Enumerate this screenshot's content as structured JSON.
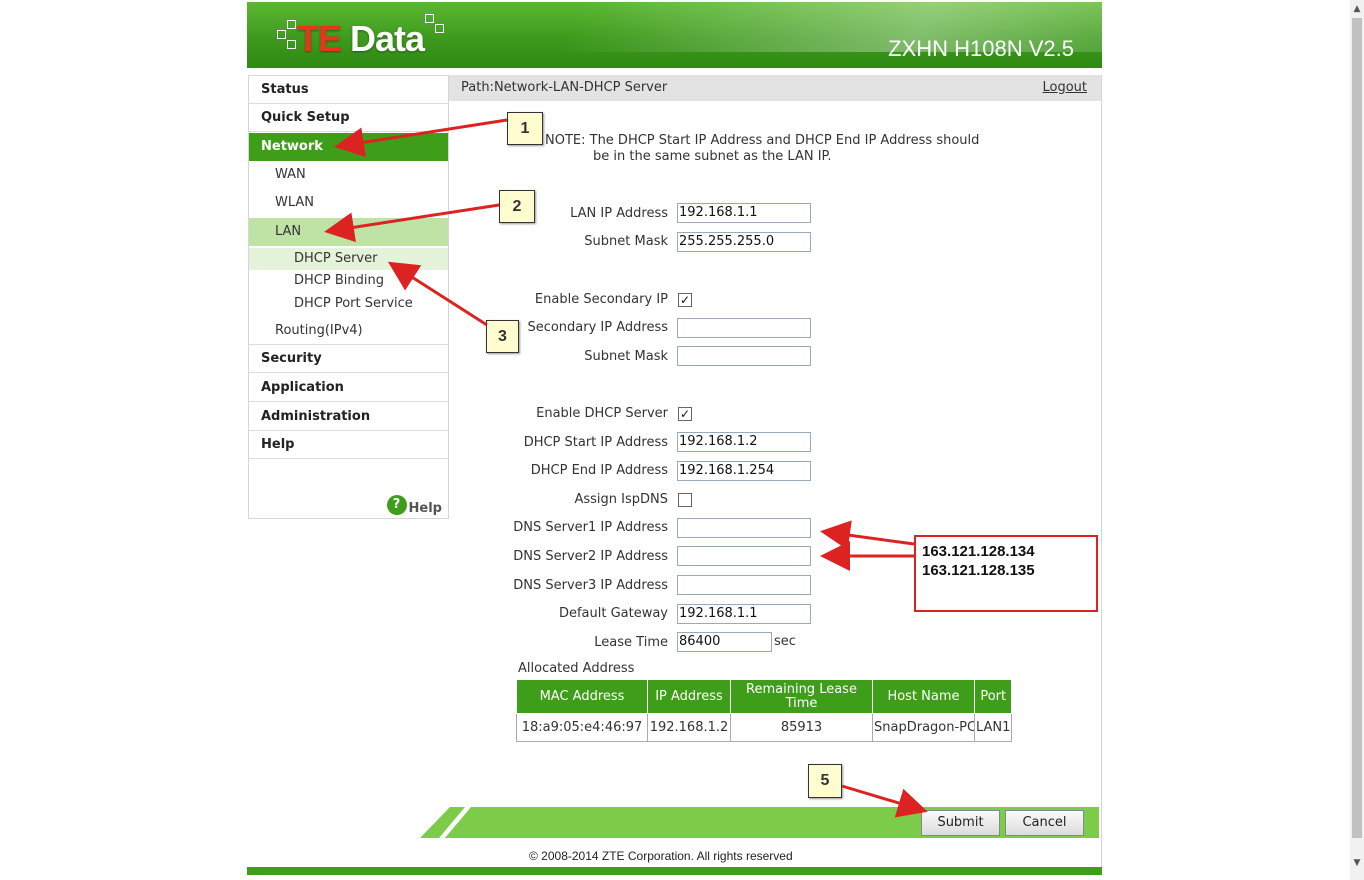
{
  "header": {
    "brand_te": "TE",
    "brand_rest": " Data",
    "model": "ZXHN H108N V2.5"
  },
  "sidebar": {
    "items": [
      {
        "label": "Status"
      },
      {
        "label": "Quick Setup"
      },
      {
        "label": "Network"
      },
      {
        "label": "WAN"
      },
      {
        "label": "WLAN"
      },
      {
        "label": "LAN"
      },
      {
        "label": "DHCP Server"
      },
      {
        "label": "DHCP Binding"
      },
      {
        "label": "DHCP Port Service"
      },
      {
        "label": "Routing(IPv4)"
      },
      {
        "label": "Security"
      },
      {
        "label": "Application"
      },
      {
        "label": "Administration"
      },
      {
        "label": "Help"
      }
    ],
    "help_link": "Help"
  },
  "path": "Path:Network-LAN-DHCP Server",
  "logout": "Logout",
  "note": {
    "line1": "NOTE: The DHCP Start IP Address and DHCP End IP Address should",
    "line2": "be in the same subnet as the LAN IP."
  },
  "form": {
    "lan_ip_label": "LAN IP Address",
    "lan_ip_value": "192.168.1.1",
    "subnet_label": "Subnet Mask",
    "subnet_value": "255.255.255.0",
    "enable_secondary_label": "Enable Secondary IP",
    "enable_secondary_checked": true,
    "secondary_ip_label": "Secondary IP Address",
    "secondary_ip_value": "",
    "secondary_subnet_label": "Subnet Mask",
    "secondary_subnet_value": "",
    "enable_dhcp_label": "Enable DHCP Server",
    "enable_dhcp_checked": true,
    "dhcp_start_label": "DHCP Start IP Address",
    "dhcp_start_value": "192.168.1.2",
    "dhcp_end_label": "DHCP End IP Address",
    "dhcp_end_value": "192.168.1.254",
    "assign_isp_dns_label": "Assign IspDNS",
    "assign_isp_dns_checked": false,
    "dns1_label": "DNS Server1 IP Address",
    "dns1_value": "",
    "dns2_label": "DNS Server2 IP Address",
    "dns2_value": "",
    "dns3_label": "DNS Server3 IP Address",
    "dns3_value": "",
    "gateway_label": "Default Gateway",
    "gateway_value": "192.168.1.1",
    "lease_label": "Lease Time",
    "lease_value": "86400",
    "lease_unit": "sec"
  },
  "allocated": {
    "title": "Allocated Address",
    "columns": [
      "MAC Address",
      "IP Address",
      "Remaining Lease Time",
      "Host Name",
      "Port"
    ],
    "rows": [
      [
        "18:a9:05:e4:46:97",
        "192.168.1.2",
        "85913",
        "SnapDragon-PC",
        "LAN1"
      ]
    ]
  },
  "buttons": {
    "submit": "Submit",
    "cancel": "Cancel"
  },
  "copyright": "© 2008-2014 ZTE Corporation. All rights reserved",
  "annotations": {
    "step1": "1",
    "step2": "2",
    "step3": "3",
    "step5": "5",
    "dns_primary": "163.121.128.134",
    "dns_secondary": "163.121.128.135"
  },
  "colors": {
    "brand_green": "#3f9e19",
    "light_green": "#7ccc4a",
    "annotation_red": "#dd2222"
  }
}
